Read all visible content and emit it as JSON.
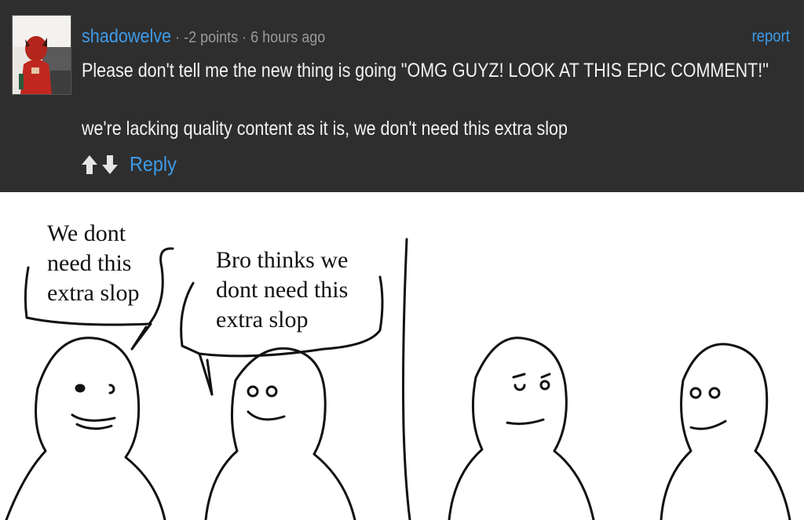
{
  "comment": {
    "username": "shadowelve",
    "points": "-2 points",
    "age": "6 hours ago",
    "separator": "·",
    "report_label": "report",
    "line1": "Please don't tell me the new thing is going \"OMG GUYZ! LOOK AT THIS EPIC COMMENT!\"",
    "line2": "we're lacking quality content as it is, we don't need this extra slop",
    "reply_label": "Reply",
    "colors": {
      "background": "#2e2e2e",
      "link": "#3d9be9",
      "meta": "#9a9a9a",
      "text": "#f2f2f2"
    }
  },
  "meme": {
    "speech1": [
      "We dont",
      "need this",
      "extra slop"
    ],
    "speech2": [
      "Bro thinks we",
      "dont need this",
      "extra slop"
    ]
  }
}
